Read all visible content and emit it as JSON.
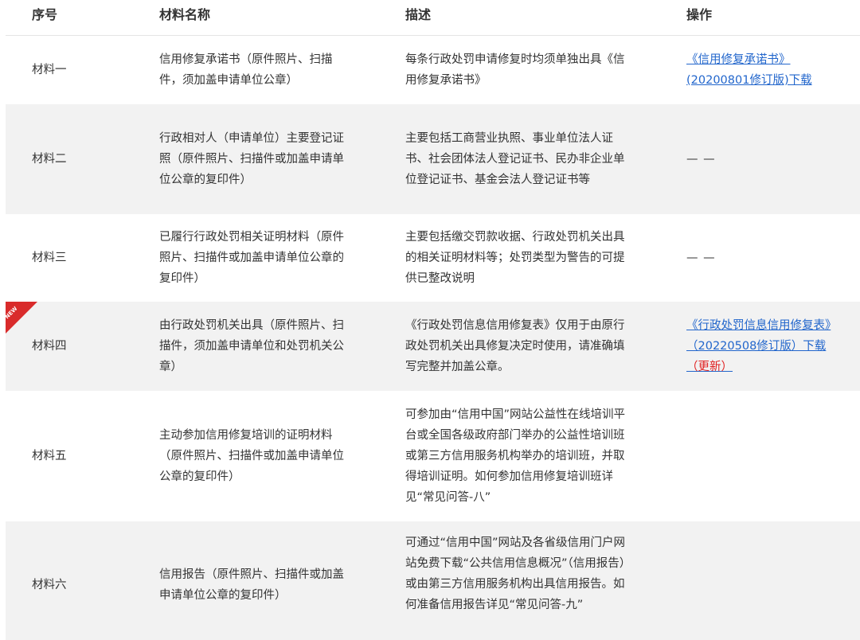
{
  "header": {
    "no": "序号",
    "name": "材料名称",
    "desc": "描述",
    "action": "操作"
  },
  "rows": [
    {
      "no": "材料一",
      "name": "信用修复承诺书（原件照片、扫描件，须加盖申请单位公章）",
      "desc": "每条行政处罚申请修复时均须单独出具《信用修复承诺书》",
      "action_link": "《信用修复承诺书》(20200801修订版)下载",
      "action_link_suffix": "",
      "action_text": ""
    },
    {
      "no": "材料二",
      "name": "行政相对人（申请单位）主要登记证照（原件照片、扫描件或加盖申请单位公章的复印件）",
      "desc": "主要包括工商营业执照、事业单位法人证书、社会团体法人登记证书、民办非企业单位登记证书、基金会法人登记证书等",
      "action_link": "",
      "action_link_suffix": "",
      "action_text": "— —"
    },
    {
      "no": "材料三",
      "name": "已履行行政处罚相关证明材料（原件照片、扫描件或加盖申请单位公章的复印件）",
      "desc": "主要包括缴交罚款收据、行政处罚机关出具的相关证明材料等；处罚类型为警告的可提供已整改说明",
      "action_link": "",
      "action_link_suffix": "",
      "action_text": "— —"
    },
    {
      "no": "材料四",
      "badge": "NEW",
      "name": "由行政处罚机关出具（原件照片、扫描件，须加盖申请单位和处罚机关公章）",
      "desc": "《行政处罚信息信用修复表》仅用于由原行政处罚机关出具修复决定时使用，请准确填写完整并加盖公章。",
      "action_link": "《行政处罚信息信用修复表》（20220508修订版）下载",
      "action_link_suffix": "（更新）",
      "action_text": ""
    },
    {
      "no": "材料五",
      "name": "主动参加信用修复培训的证明材料（原件照片、扫描件或加盖申请单位公章的复印件）",
      "desc": "可参加由“信用中国”网站公益性在线培训平台或全国各级政府部门举办的公益性培训班或第三方信用服务机构举办的培训班，并取得培训证明。如何参加信用修复培训班详见“常见问答-八”",
      "action_link": "",
      "action_link_suffix": "",
      "action_text": ""
    },
    {
      "no": "材料六",
      "name": "信用报告（原件照片、扫描件或加盖申请单位公章的复印件）",
      "desc": "可通过“信用中国”网站及各省级信用门户网站免费下载“公共信用信息概况”（信用报告）或由第三方信用服务机构出具信用报告。如何准备信用报告详见“常见问答-九”",
      "action_link": "",
      "action_link_suffix": "",
      "action_text": ""
    }
  ]
}
